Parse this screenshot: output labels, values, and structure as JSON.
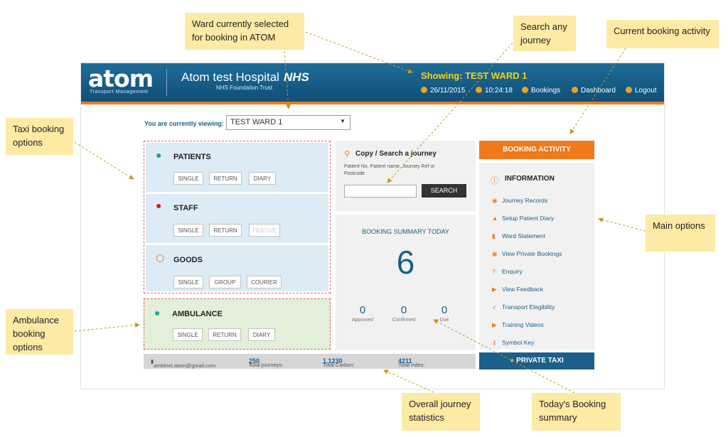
{
  "header": {
    "logo": "atom",
    "logo_sub": "Transport Management",
    "hospital": "Atom test Hospital",
    "nhs": "NHS",
    "hospital_sub": "NHS Foundation Trust",
    "showing": "Showing: TEST WARD 1",
    "date": "26/11/2015",
    "time": "10:24:18",
    "bookings": "Bookings",
    "dashboard": "Dashboard",
    "logout": "Logout"
  },
  "ward": {
    "label": "You are currently viewing:",
    "selected": "TEST WARD 1"
  },
  "patients": {
    "title": "PATIENTS",
    "buttons": [
      "SINGLE",
      "RETURN",
      "DIARY"
    ]
  },
  "staff": {
    "title": "STAFF",
    "buttons": [
      "SINGLE",
      "RETURN",
      "FESTIVE"
    ]
  },
  "goods": {
    "title": "GOODS",
    "buttons": [
      "SINGLE",
      "GROUP",
      "COURIER"
    ]
  },
  "ambulance": {
    "title": "AMBULANCE",
    "buttons": [
      "SINGLE",
      "RETURN",
      "DIARY"
    ]
  },
  "search": {
    "title": "Copy / Search a journey",
    "hint": "Patient No, Patient name, Journey Ref or Postcode",
    "value": "",
    "button": "SEARCH"
  },
  "summary": {
    "title": "BOOKING SUMMARY TODAY",
    "total": "6",
    "approved_value": "0",
    "approved_label": "Approved",
    "confirmed_value": "0",
    "confirmed_label": "Confirmed",
    "due_value": "0",
    "due_label": "Due"
  },
  "stats": {
    "email": "ambinet.atom@gmail.com",
    "journeys_label": "Total journeys:",
    "journeys": "250",
    "carbon_label": "Total Carbon:",
    "carbon": "1.1230",
    "miles_label": "Total miles:",
    "miles": "4211"
  },
  "activity": {
    "button": "BOOKING ACTIVITY"
  },
  "info": {
    "title": "INFORMATION",
    "options": [
      "Journey Records",
      "Setup Patient Diary",
      "Ward Statement",
      "View Private Bookings",
      "Enquiry",
      "View Feedback",
      "Transport Elegibility",
      "Training Videos",
      "Symbol Key"
    ]
  },
  "private_taxi": {
    "label": "PRIVATE TAXI"
  },
  "callouts": {
    "ward": "Ward currently selected for booking in ATOM",
    "search": "Search any journey",
    "activity": "Current booking activity",
    "taxi": "Taxi booking options",
    "main": "Main options",
    "ambulance": "Ambulance booking options",
    "overall": "Overall journey statistics",
    "today": "Today's Booking summary"
  },
  "colors": {
    "brand_blue": "#1b5f8a",
    "accent_orange": "#f07a1a",
    "showing_yellow": "#f6d11d",
    "note_bg": "#fdeaa4"
  }
}
